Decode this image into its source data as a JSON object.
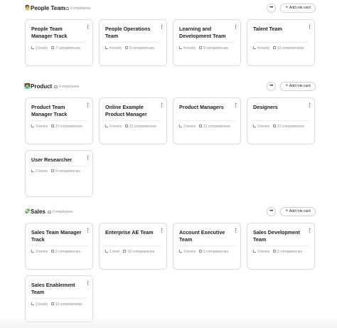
{
  "sections": [
    {
      "emoji": "🧑‍💼",
      "title": "People Team",
      "employees": "0 employees",
      "more_label": "•••",
      "add_label": "Add role card",
      "cards": [
        {
          "title": "People Team Manager Track",
          "levels": "3 levels",
          "competencies": "7 competencies"
        },
        {
          "title": "People Operations Team",
          "levels": "4 levels",
          "competencies": "9 competencies"
        },
        {
          "title": "Learning and Development Team",
          "levels": "4 levels",
          "competencies": "9 competencies"
        },
        {
          "title": "Talent Team",
          "levels": "4 levels",
          "competencies": "10 competencies"
        }
      ]
    },
    {
      "emoji": "👨‍💻",
      "title": "Product",
      "employees": "0 employees",
      "more_label": "•••",
      "add_label": "Add role card",
      "cards": [
        {
          "title": "Product Team Manager Track",
          "levels": "3 levels",
          "competencies": "10 competencies"
        },
        {
          "title": "Online Example Product Manager",
          "levels": "6 levels",
          "competencies": "13 competencies"
        },
        {
          "title": "Product Managers",
          "levels": "2 levels",
          "competencies": "13 competencies"
        },
        {
          "title": "Designers",
          "levels": "3 levels",
          "competencies": "10 competencies"
        },
        {
          "title": "User Researcher",
          "levels": "2 levels",
          "competencies": "9 competencies"
        }
      ]
    },
    {
      "emoji": "💸",
      "title": "Sales",
      "employees": "0 employees",
      "more_label": "•••",
      "add_label": "Add role card",
      "cards": [
        {
          "title": "Sales Team Manager Track",
          "levels": "3 levels",
          "competencies": "9 competencies"
        },
        {
          "title": "Enterprise AE Team",
          "levels": "1 level",
          "competencies": "10 competencies"
        },
        {
          "title": "Account Executive Team",
          "levels": "3 levels",
          "competencies": "9 competencies"
        },
        {
          "title": "Sales Development Team",
          "levels": "3 levels",
          "competencies": "9 competencies"
        },
        {
          "title": "Sales Enablement Team",
          "levels": "3 levels",
          "competencies": "10 competencies"
        }
      ]
    }
  ]
}
